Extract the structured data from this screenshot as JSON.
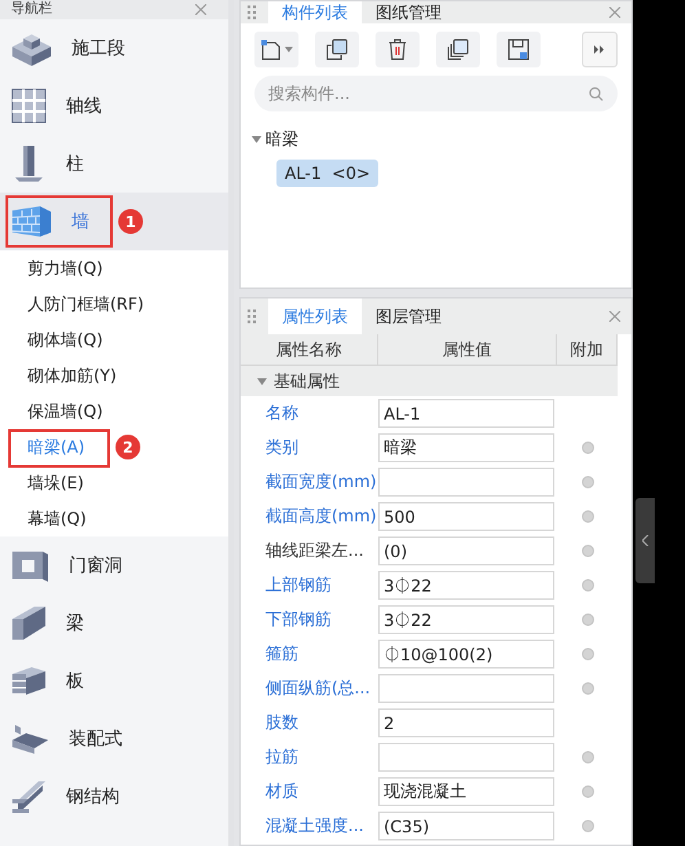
{
  "nav_panel": {
    "title": "导航栏",
    "items": [
      {
        "label": "施工段",
        "selected": false
      },
      {
        "label": "轴线",
        "selected": false
      },
      {
        "label": "柱",
        "selected": false
      },
      {
        "label": "墙",
        "selected": true,
        "badge": "1",
        "children": [
          {
            "label": "剪力墙(Q)",
            "selected": false
          },
          {
            "label": "人防门框墙(RF)",
            "selected": false
          },
          {
            "label": "砌体墙(Q)",
            "selected": false
          },
          {
            "label": "砌体加筋(Y)",
            "selected": false
          },
          {
            "label": "保温墙(Q)",
            "selected": false
          },
          {
            "label": "暗梁(A)",
            "selected": true,
            "badge": "2"
          },
          {
            "label": "墙垛(E)",
            "selected": false
          },
          {
            "label": "幕墙(Q)",
            "selected": false
          }
        ]
      },
      {
        "label": "门窗洞",
        "selected": false
      },
      {
        "label": "梁",
        "selected": false
      },
      {
        "label": "板",
        "selected": false
      },
      {
        "label": "装配式",
        "selected": false
      },
      {
        "label": "钢结构",
        "selected": false
      }
    ]
  },
  "component_panel": {
    "tabs": [
      {
        "label": "构件列表",
        "selected": true
      },
      {
        "label": "图纸管理",
        "selected": false
      }
    ],
    "search": {
      "placeholder": "搜索构件..."
    },
    "tree": [
      {
        "label": "暗梁",
        "expanded": true,
        "children": [
          {
            "label": "AL-1  <0>",
            "selected": true
          }
        ]
      }
    ]
  },
  "property_panel": {
    "tabs": [
      {
        "label": "属性列表",
        "selected": true
      },
      {
        "label": "图层管理",
        "selected": false
      }
    ],
    "columns": [
      "属性名称",
      "属性值",
      "附加"
    ],
    "group": {
      "label": "基础属性",
      "expanded": true
    },
    "rows": [
      {
        "name": "名称",
        "value": "AL-1",
        "color": "#2b6fd6",
        "kind": "plain"
      },
      {
        "name": "类别",
        "value": "暗梁",
        "color": "#2b6fd6",
        "kind": "checkbox",
        "checked": false
      },
      {
        "name": "截面宽度(mm)",
        "value": "",
        "color": "#2b6fd6",
        "kind": "checkbox",
        "checked": false
      },
      {
        "name": "截面高度(mm)",
        "value": "500",
        "color": "#2b6fd6",
        "kind": "checkbox",
        "checked": false
      },
      {
        "name": "轴线距梁左...",
        "value": "(0)",
        "color": "#333333",
        "kind": "checkbox",
        "checked": false
      },
      {
        "name": "上部钢筋",
        "value": "3⏀22",
        "color": "#2b6fd6",
        "kind": "checkbox",
        "checked": false
      },
      {
        "name": "下部钢筋",
        "value": "3⏀22",
        "color": "#2b6fd6",
        "kind": "checkbox",
        "checked": false
      },
      {
        "name": "箍筋",
        "value": "⏀10@100(2)",
        "color": "#2b6fd6",
        "kind": "checkbox",
        "checked": false
      },
      {
        "name": "侧面纵筋(总...",
        "value": "",
        "color": "#2b6fd6",
        "kind": "checkbox",
        "checked": false
      },
      {
        "name": "肢数",
        "value": "2",
        "color": "#2b6fd6",
        "kind": "plain"
      },
      {
        "name": "拉筋",
        "value": "",
        "color": "#2b6fd6",
        "kind": "checkbox",
        "checked": false
      },
      {
        "name": "材质",
        "value": "现浇混凝土",
        "color": "#2b6fd6",
        "kind": "checkbox",
        "checked": false
      },
      {
        "name": "混凝土强度...",
        "value": "(C35)",
        "color": "#2b6fd6",
        "kind": "checkbox",
        "checked": false
      }
    ]
  }
}
